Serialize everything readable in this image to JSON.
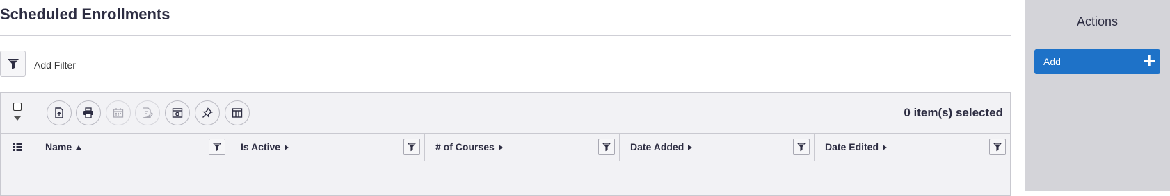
{
  "page": {
    "title": "Scheduled Enrollments"
  },
  "filter_bar": {
    "add_filter_label": "Add Filter"
  },
  "grid": {
    "toolbar": {
      "buttons": [
        {
          "name": "export-icon",
          "enabled": true
        },
        {
          "name": "print-icon",
          "enabled": true
        },
        {
          "name": "calendar-icon",
          "enabled": false
        },
        {
          "name": "edit-document-icon",
          "enabled": false
        },
        {
          "name": "schedule-settings-icon",
          "enabled": true
        },
        {
          "name": "pin-icon",
          "enabled": true
        },
        {
          "name": "columns-icon",
          "enabled": true
        }
      ],
      "selected_count": "0 item(s) selected"
    },
    "columns": [
      {
        "label": "Name",
        "sort": "asc"
      },
      {
        "label": "Is Active",
        "sort": "none"
      },
      {
        "label": "# of Courses",
        "sort": "none"
      },
      {
        "label": "Date Added",
        "sort": "none"
      },
      {
        "label": "Date Edited",
        "sort": "none"
      }
    ],
    "rows": []
  },
  "sidebar": {
    "title": "Actions",
    "add_label": "Add",
    "add_color": "#1e72c8"
  }
}
